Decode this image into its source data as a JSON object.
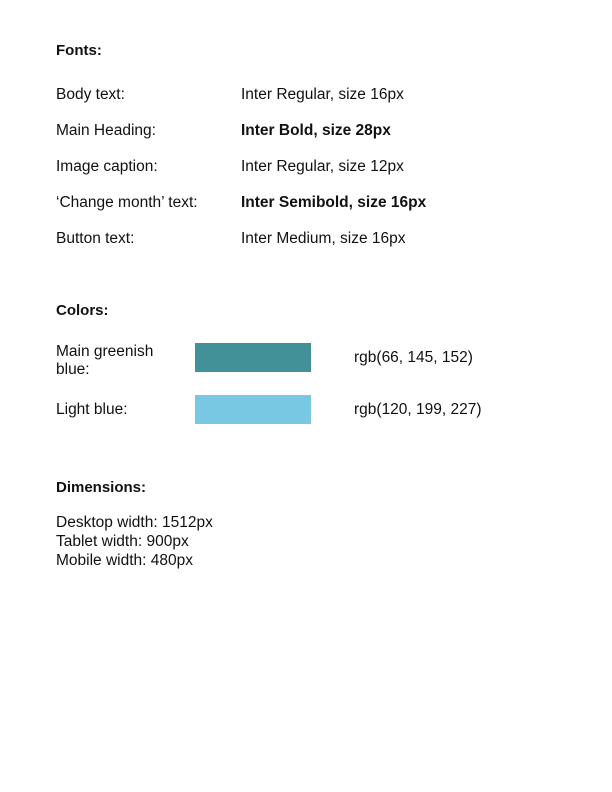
{
  "fonts": {
    "title": "Fonts:",
    "rows": [
      {
        "label": "Body text:",
        "value": "Inter Regular, size 16px",
        "bold": false
      },
      {
        "label": "Main Heading:",
        "value": "Inter Bold, size 28px",
        "bold": true
      },
      {
        "label": "Image caption:",
        "value": "Inter Regular, size 12px",
        "bold": false
      },
      {
        "label": "‘Change month’ text:",
        "value": "Inter Semibold, size 16px",
        "bold": true
      },
      {
        "label": "Button text:",
        "value": "Inter Medium, size 16px",
        "bold": false
      }
    ]
  },
  "colors": {
    "title": "Colors:",
    "rows": [
      {
        "label": "Main greenish blue:",
        "value": "rgb(66, 145, 152)",
        "swatch": "#429198"
      },
      {
        "label": "Light blue:",
        "value": "rgb(120, 199, 227)",
        "swatch": "#78C7E3"
      }
    ]
  },
  "dimensions": {
    "title": "Dimensions:",
    "items": [
      "Desktop width: 1512px",
      "Tablet width: 900px",
      "Mobile width: 480px"
    ]
  }
}
